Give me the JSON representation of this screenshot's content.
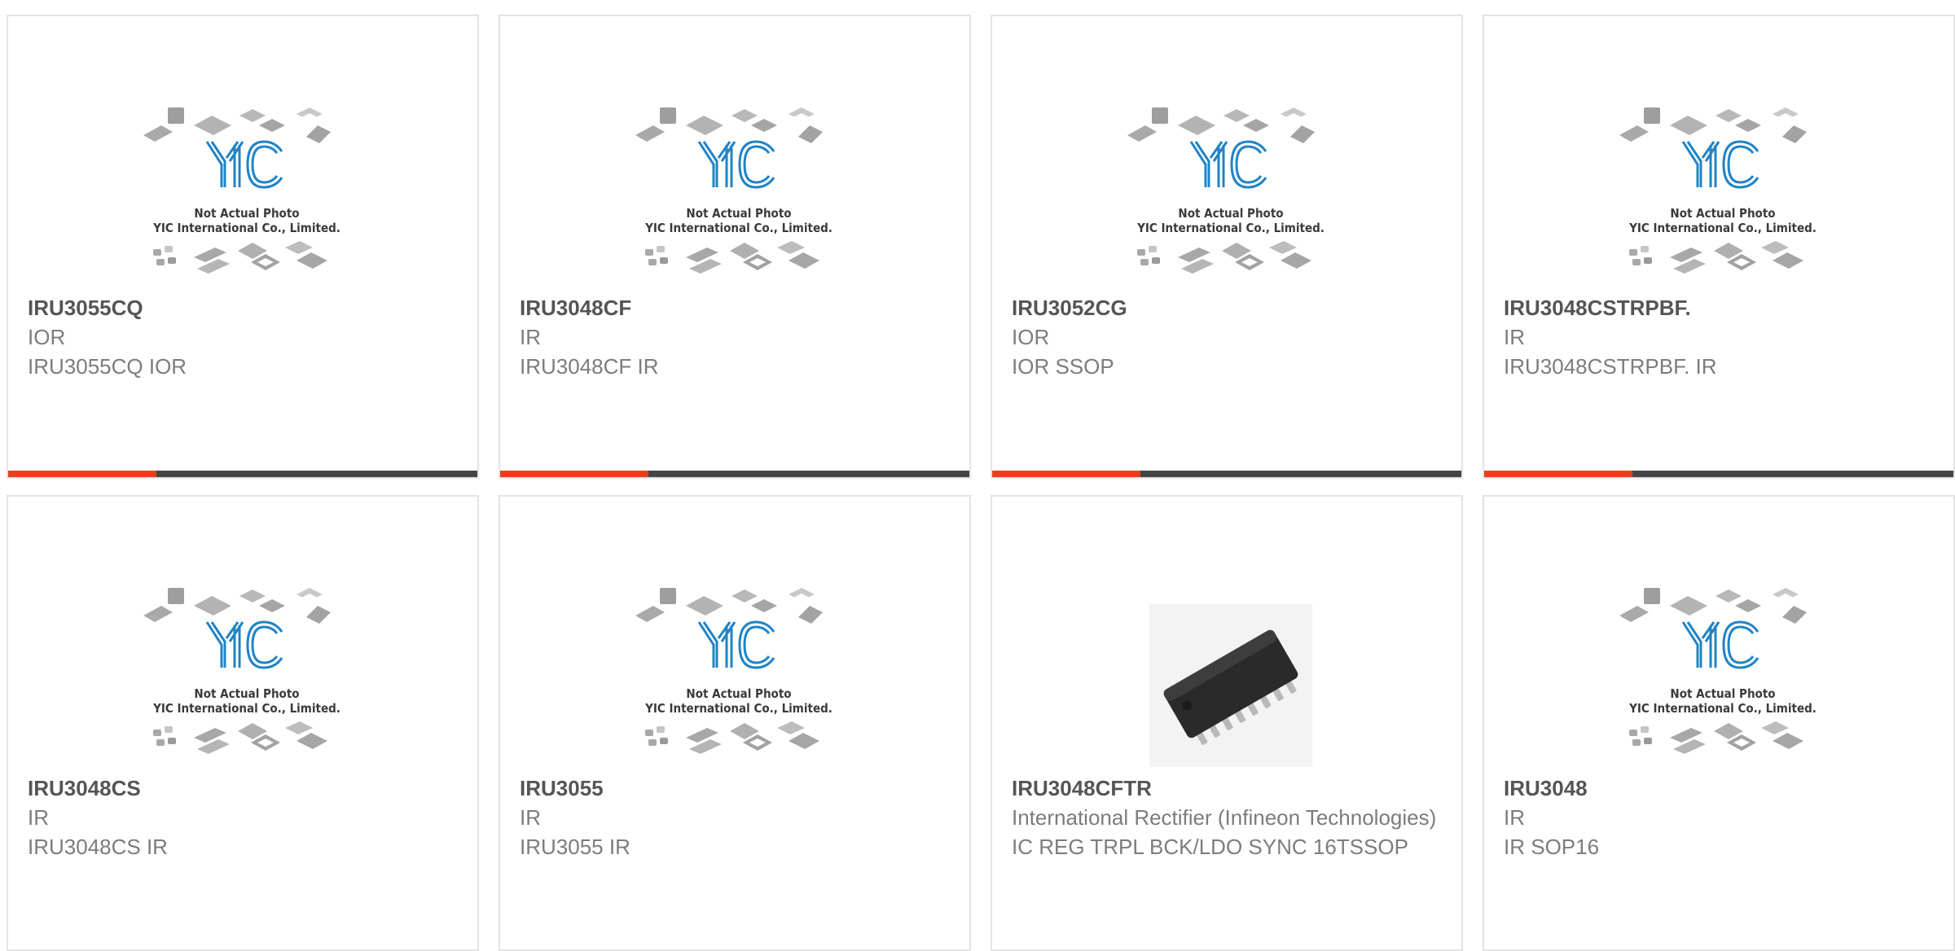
{
  "placeholder": {
    "line1": "Not Actual Photo",
    "line2": "YIC International Co., Limited.",
    "logo": "YIC"
  },
  "colors": {
    "accent": "#e8401c",
    "bar": "#454545",
    "logo": "#1f84c6"
  },
  "products": [
    {
      "part": "IRU3055CQ",
      "manufacturer": "IOR",
      "description": "IRU3055CQ IOR",
      "image": "placeholder"
    },
    {
      "part": "IRU3048CF",
      "manufacturer": "IR",
      "description": "IRU3048CF IR",
      "image": "placeholder"
    },
    {
      "part": "IRU3052CG",
      "manufacturer": "IOR",
      "description": "IOR SSOP",
      "image": "placeholder"
    },
    {
      "part": "IRU3048CSTRPBF.",
      "manufacturer": "IR",
      "description": "IRU3048CSTRPBF. IR",
      "image": "placeholder"
    },
    {
      "part": "IRU3048CS",
      "manufacturer": "IR",
      "description": "IRU3048CS IR",
      "image": "placeholder"
    },
    {
      "part": "IRU3055",
      "manufacturer": "IR",
      "description": "IRU3055 IR",
      "image": "placeholder"
    },
    {
      "part": "IRU3048CFTR",
      "manufacturer": "International Rectifier (Infineon Technologies)",
      "description": "IC REG TRPL BCK/LDO SYNC 16TSSOP",
      "image": "tssop-chip"
    },
    {
      "part": "IRU3048",
      "manufacturer": "IR",
      "description": "IR SOP16",
      "image": "placeholder"
    }
  ]
}
